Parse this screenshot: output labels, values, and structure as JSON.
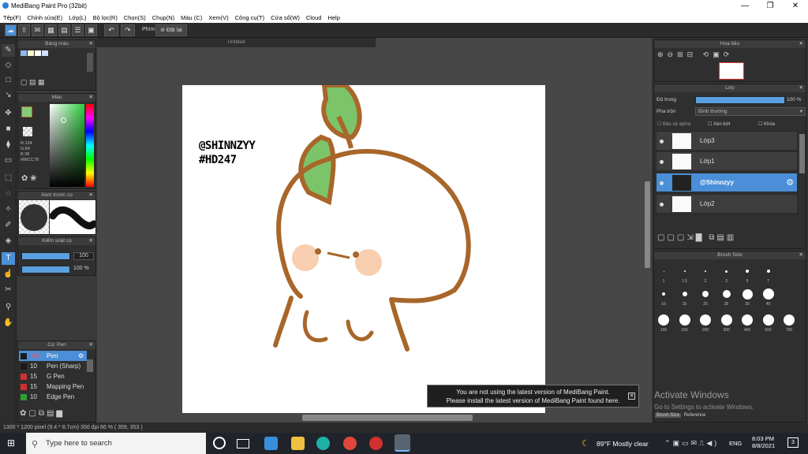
{
  "window": {
    "title": "MediBang Paint Pro (32bit)",
    "min": "—",
    "max": "❐",
    "close": "✕"
  },
  "menu": [
    "Tệp(F)",
    "Chỉnh sửa(E)",
    "Lớp(L)",
    "Bộ lọc(R)",
    "Chọn(S)",
    "Chụp(N)",
    "Màu (C)",
    "Xem(V)",
    "Công cụ(T)",
    "Cửa sổ(W)",
    "Cloud",
    "Help"
  ],
  "toolbar": {
    "shortcut_label": "Phím",
    "reset_label": "Đặt lại"
  },
  "panels": {
    "palette": "Bảng màu",
    "color": "Màu",
    "color_values": [
      "R:134",
      "G:84",
      "B:38",
      "#86CC78"
    ],
    "preview": "Xem trước cọ",
    "control": "Kiểm soát cọ",
    "control_size": "100",
    "control_opacity": "100 %",
    "brush": "Cọ: Pen",
    "navigator": "Hoa tiêu",
    "layer": "Lớp",
    "brushsize": "Brush Size"
  },
  "brushes": [
    {
      "size": "100",
      "name": "Pen",
      "color": "#1a1a1a",
      "active": true
    },
    {
      "size": "10",
      "name": "Pen (Sharp)",
      "color": "#1a1a1a",
      "active": false
    },
    {
      "size": "15",
      "name": "G Pen",
      "color": "#d03030",
      "active": false
    },
    {
      "size": "15",
      "name": "Mapping Pen",
      "color": "#d03030",
      "active": false
    },
    {
      "size": "10",
      "name": "Edge Pen",
      "color": "#30a030",
      "active": false
    }
  ],
  "canvas": {
    "tab": "Untitled",
    "signature_line1": "@SHINNZYY",
    "signature_line2": "#HD247"
  },
  "notice": {
    "line1": "You are not using the latest version of MediBang Paint.",
    "line2": "Please install the latest version of MediBang Paint found here."
  },
  "layer_panel": {
    "opacity_label": "Độ trong",
    "opacity_value": "100 %",
    "blend_label": "Pha trộn",
    "blend_value": "Bình thường",
    "protect_alpha": "Bảo vệ alpha",
    "clipping": "Xén bớt",
    "lock": "Khóa",
    "layers": [
      "Lớp3",
      "Lớp1",
      "@Shinnzyy",
      "Lớp2"
    ],
    "active_index": 2
  },
  "brush_sizes": {
    "row1": [
      "1",
      "1.5",
      "2",
      "3",
      "5",
      "7"
    ],
    "row2": [
      "10",
      "15",
      "20",
      "25",
      "30",
      "40"
    ],
    "row3": [
      "100",
      "150",
      "200",
      "300",
      "400",
      "500",
      "700"
    ],
    "tabs": [
      "Brush Size",
      "Reference"
    ]
  },
  "watermark": {
    "title": "Activate Windows",
    "subtitle": "Go to Settings to activate Windows."
  },
  "status": "1300 * 1200 pixel   (9.4 * 8.7cm)   350 dpi   66 %   ( 359, 353 )",
  "taskbar": {
    "search_placeholder": "Type here to search",
    "weather": "89°F  Mostly clear",
    "lang": "ENG",
    "time": "8:03 PM",
    "date": "8/8/2021",
    "notif": "3"
  },
  "colors": {
    "accent": "#4a8fd8",
    "sprout": "#7cc46a",
    "stroke": "#a8662a",
    "blush": "#f7cfb0"
  }
}
